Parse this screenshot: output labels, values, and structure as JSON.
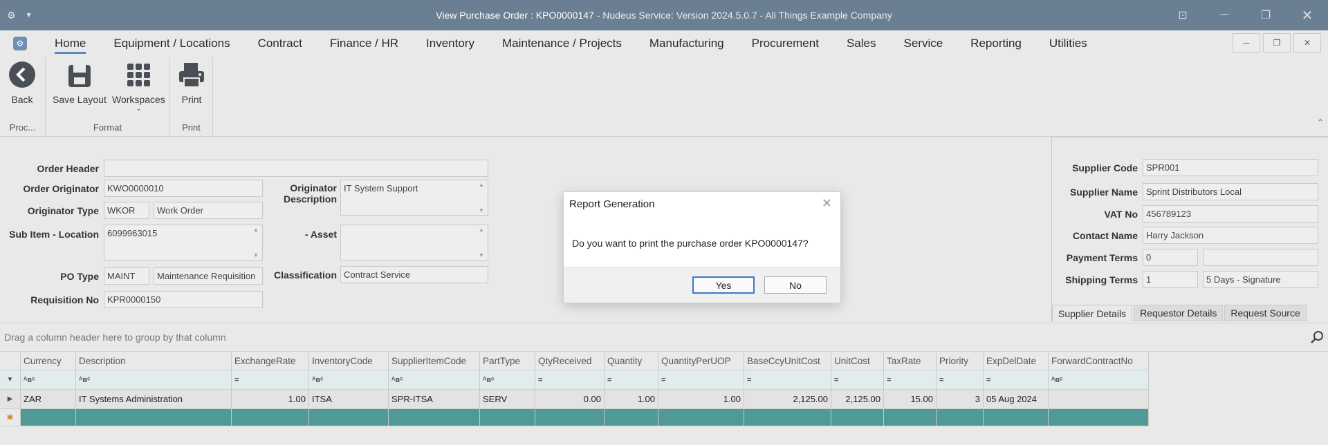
{
  "window": {
    "title_main": "View Purchase Order : KPO0000147",
    "title_rest": " - Nudeus Service: Version 2024.5.0.7 - All Things Example Company"
  },
  "menu": {
    "items": [
      {
        "label": "Home"
      },
      {
        "label": "Equipment / Locations"
      },
      {
        "label": "Contract"
      },
      {
        "label": "Finance / HR"
      },
      {
        "label": "Inventory"
      },
      {
        "label": "Maintenance / Projects"
      },
      {
        "label": "Manufacturing"
      },
      {
        "label": "Procurement"
      },
      {
        "label": "Sales"
      },
      {
        "label": "Service"
      },
      {
        "label": "Reporting"
      },
      {
        "label": "Utilities"
      }
    ]
  },
  "ribbon": {
    "back": "Back",
    "save_layout": "Save Layout",
    "workspaces": "Workspaces",
    "print": "Print",
    "group_proc": "Proc...",
    "group_format": "Format",
    "group_print": "Print"
  },
  "form": {
    "order_header_label": "Order Header",
    "order_header_value": "",
    "originator_label": "Order Originator",
    "originator_value": "KWO0000010",
    "originator_type_label": "Originator Type",
    "originator_type_code": "WKOR",
    "originator_type_desc": "Work Order",
    "sub_item_label": "Sub Item - Location",
    "sub_item_value": "6099963015",
    "originator_desc_label": "Originator Description",
    "originator_desc_value": "IT System Support",
    "asset_label": "- Asset",
    "asset_value": "",
    "po_type_label": "PO Type",
    "po_type_code": "MAINT",
    "po_type_desc": "Maintenance Requisition",
    "classification_label": "Classification",
    "classification_value": "Contract Service",
    "requisition_label": "Requisition No",
    "requisition_value": "KPR0000150"
  },
  "supplier": {
    "code_label": "Supplier Code",
    "code_value": "SPR001",
    "name_label": "Supplier Name",
    "name_value": "Sprint Distributors Local",
    "vat_label": "VAT No",
    "vat_value": "456789123",
    "contact_label": "Contact Name",
    "contact_value": "Harry Jackson",
    "payment_label": "Payment Terms",
    "payment_code": "0",
    "payment_desc": "",
    "shipping_label": "Shipping Terms",
    "shipping_code": "1",
    "shipping_desc": "5 Days - Signature",
    "tabs": [
      "Supplier Details",
      "Requestor Details",
      "Request Source"
    ]
  },
  "grid": {
    "group_hint": "Drag a column header here to group by that column",
    "columns": [
      "Currency",
      "Description",
      "ExchangeRate",
      "InventoryCode",
      "SupplierItemCode",
      "PartType",
      "QtyReceived",
      "Quantity",
      "QuantityPerUOP",
      "BaseCcyUnitCost",
      "UnitCost",
      "TaxRate",
      "Priority",
      "ExpDelDate",
      "ForwardContractNo"
    ],
    "row": [
      "ZAR",
      "IT Systems Administration",
      "1.00",
      "ITSA",
      "SPR-ITSA",
      "SERV",
      "0.00",
      "1.00",
      "1.00",
      "2,125.00",
      "2,125.00",
      "15.00",
      "3",
      "05 Aug 2024",
      ""
    ]
  },
  "dialog": {
    "title": "Report Generation",
    "message": "Do you want to print the purchase order KPO0000147?",
    "yes": "Yes",
    "no": "No"
  }
}
